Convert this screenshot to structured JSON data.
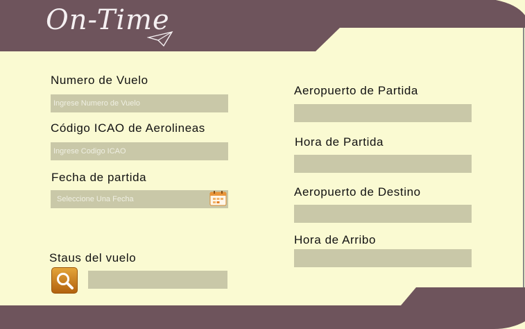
{
  "brand": {
    "logo_text": "On-Time"
  },
  "form_left": {
    "flight_number": {
      "label": "Numero de Vuelo",
      "placeholder": "Ingrese Numero de Vuelo"
    },
    "icao_code": {
      "label": "Código ICAO de Aerolineas",
      "placeholder": "Ingrese Codigo ICAO"
    },
    "departure_date": {
      "label": "Fecha de partida",
      "placeholder": "Seleccione Una Fecha",
      "icon": "calendar-icon"
    },
    "status": {
      "label": "Staus del vuelo",
      "value": "",
      "button_icon": "search-icon"
    }
  },
  "form_right": {
    "departure_airport": {
      "label": "Aeropuerto de Partida",
      "value": ""
    },
    "departure_time": {
      "label": "Hora de Partida",
      "value": ""
    },
    "arrival_airport": {
      "label": "Aeropuerto de Destino",
      "value": ""
    },
    "arrival_time": {
      "label": "Hora de Arribo",
      "value": ""
    }
  },
  "colors": {
    "header": "#6e545c",
    "background": "#fafad2",
    "field": "#c9c8a8",
    "search_button": "#c8801f"
  }
}
